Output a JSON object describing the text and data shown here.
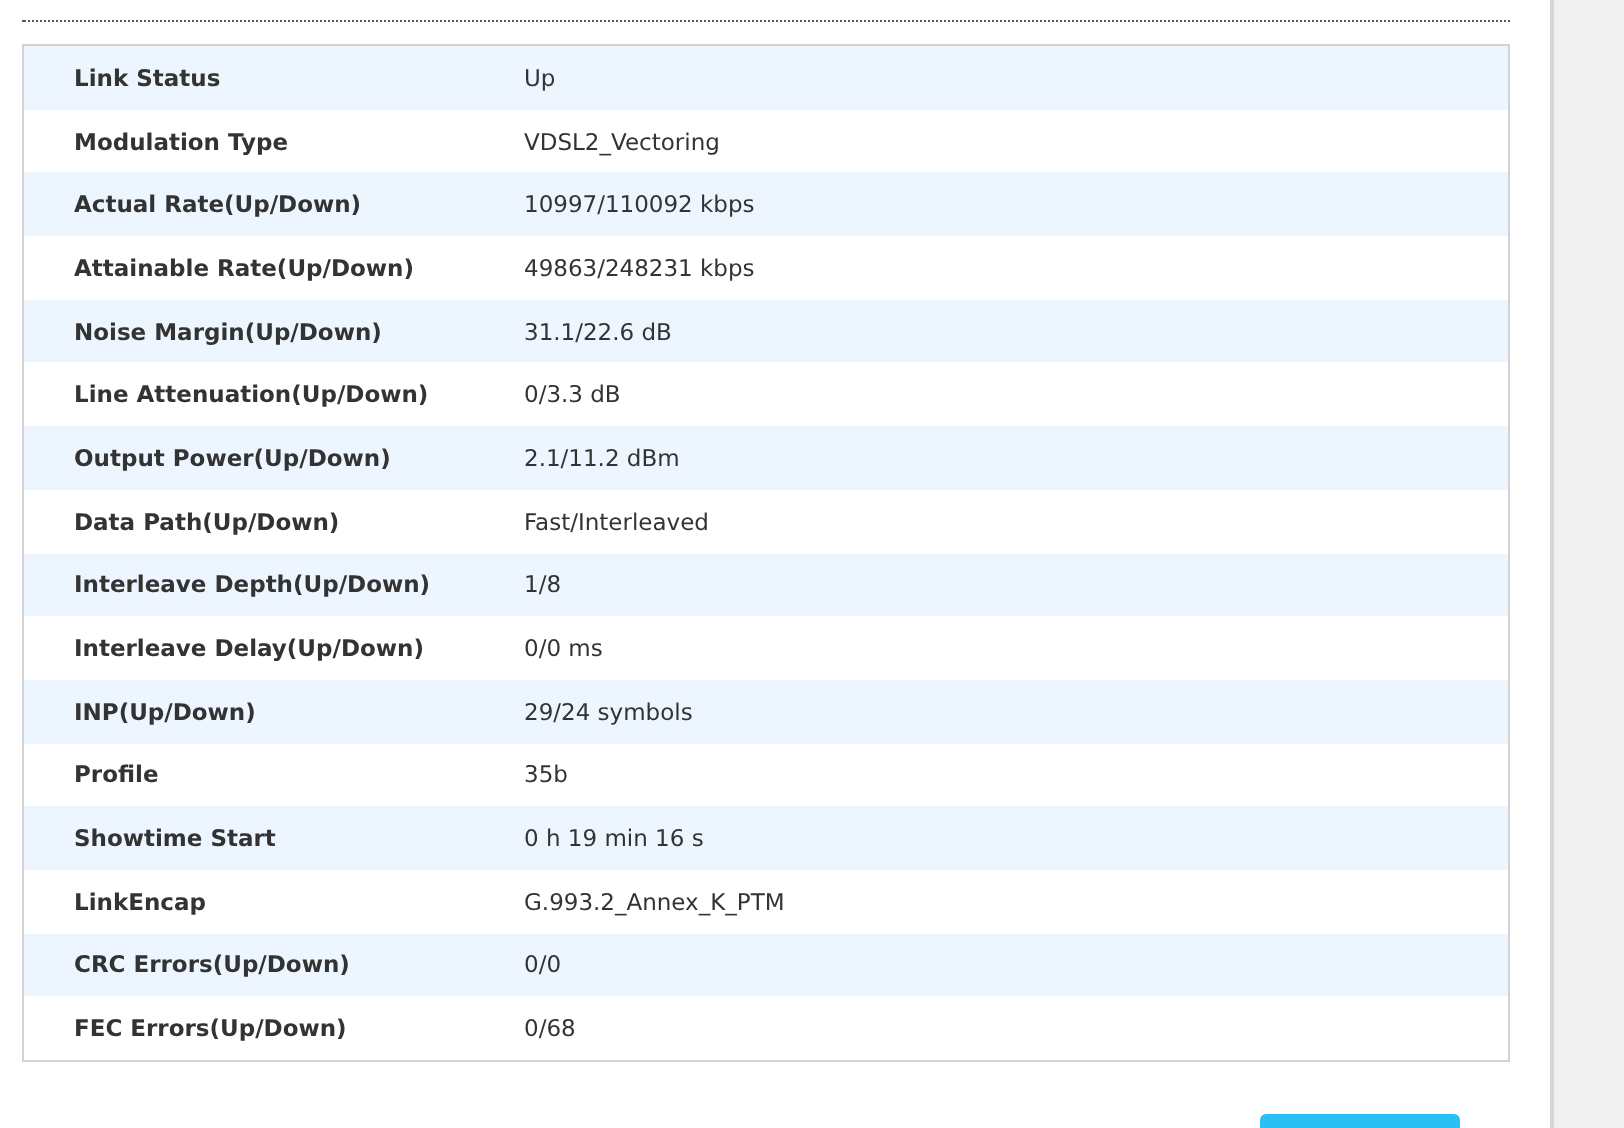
{
  "rows": [
    {
      "label": "Link Status",
      "value": "Up"
    },
    {
      "label": "Modulation Type",
      "value": "VDSL2_Vectoring"
    },
    {
      "label": "Actual Rate(Up/Down)",
      "value": "10997/110092 kbps"
    },
    {
      "label": "Attainable Rate(Up/Down)",
      "value": "49863/248231 kbps"
    },
    {
      "label": "Noise Margin(Up/Down)",
      "value": "31.1/22.6 dB"
    },
    {
      "label": "Line Attenuation(Up/Down)",
      "value": "0/3.3 dB"
    },
    {
      "label": "Output Power(Up/Down)",
      "value": "2.1/11.2 dBm"
    },
    {
      "label": "Data Path(Up/Down)",
      "value": "Fast/Interleaved"
    },
    {
      "label": "Interleave Depth(Up/Down)",
      "value": "1/8"
    },
    {
      "label": "Interleave Delay(Up/Down)",
      "value": "0/0 ms"
    },
    {
      "label": "INP(Up/Down)",
      "value": "29/24 symbols"
    },
    {
      "label": "Profile",
      "value": "35b"
    },
    {
      "label": "Showtime Start",
      "value": "0 h 19 min 16 s"
    },
    {
      "label": "LinkEncap",
      "value": "G.993.2_Annex_K_PTM"
    },
    {
      "label": "CRC Errors(Up/Down)",
      "value": "0/0"
    },
    {
      "label": "FEC Errors(Up/Down)",
      "value": "0/68"
    }
  ]
}
